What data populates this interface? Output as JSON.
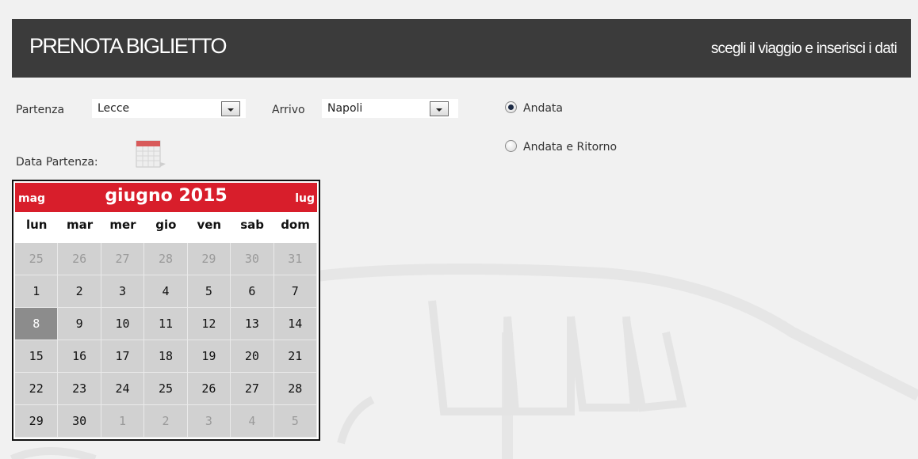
{
  "header": {
    "title": "PRENOTA BIGLIETTO",
    "subtitle": "scegli il viaggio e inserisci i dati"
  },
  "form": {
    "partenza_label": "Partenza",
    "partenza_value": "Lecce",
    "arrivo_label": "Arrivo",
    "arrivo_value": "Napoli",
    "data_partenza_label": "Data Partenza:",
    "trip_type": [
      {
        "label": "Andata",
        "checked": true
      },
      {
        "label": "Andata e Ritorno",
        "checked": false
      }
    ]
  },
  "calendar": {
    "prev": "mag",
    "next": "lug",
    "month": "giugno 2015",
    "weekdays": [
      "lun",
      "mar",
      "mer",
      "gio",
      "ven",
      "sab",
      "dom"
    ],
    "days": [
      {
        "d": "25",
        "other": true
      },
      {
        "d": "26",
        "other": true
      },
      {
        "d": "27",
        "other": true
      },
      {
        "d": "28",
        "other": true
      },
      {
        "d": "29",
        "other": true
      },
      {
        "d": "30",
        "other": true
      },
      {
        "d": "31",
        "other": true
      },
      {
        "d": "1"
      },
      {
        "d": "2"
      },
      {
        "d": "3"
      },
      {
        "d": "4"
      },
      {
        "d": "5"
      },
      {
        "d": "6"
      },
      {
        "d": "7"
      },
      {
        "d": "8",
        "today": true
      },
      {
        "d": "9"
      },
      {
        "d": "10"
      },
      {
        "d": "11"
      },
      {
        "d": "12"
      },
      {
        "d": "13"
      },
      {
        "d": "14"
      },
      {
        "d": "15"
      },
      {
        "d": "16"
      },
      {
        "d": "17"
      },
      {
        "d": "18"
      },
      {
        "d": "19"
      },
      {
        "d": "20"
      },
      {
        "d": "21"
      },
      {
        "d": "22"
      },
      {
        "d": "23"
      },
      {
        "d": "24"
      },
      {
        "d": "25"
      },
      {
        "d": "26"
      },
      {
        "d": "27"
      },
      {
        "d": "28"
      },
      {
        "d": "29"
      },
      {
        "d": "30"
      },
      {
        "d": "1",
        "other": true
      },
      {
        "d": "2",
        "other": true
      },
      {
        "d": "3",
        "other": true
      },
      {
        "d": "4",
        "other": true
      },
      {
        "d": "5",
        "other": true
      }
    ]
  },
  "colors": {
    "header_bg": "#3b3b3b",
    "calendar_header": "#d81e2b",
    "day_cell": "#d1d1d1",
    "selected_day": "#8c8c8c"
  },
  "icons": {
    "calendar_button": "calendar-icon",
    "background": "bus-watermark"
  }
}
